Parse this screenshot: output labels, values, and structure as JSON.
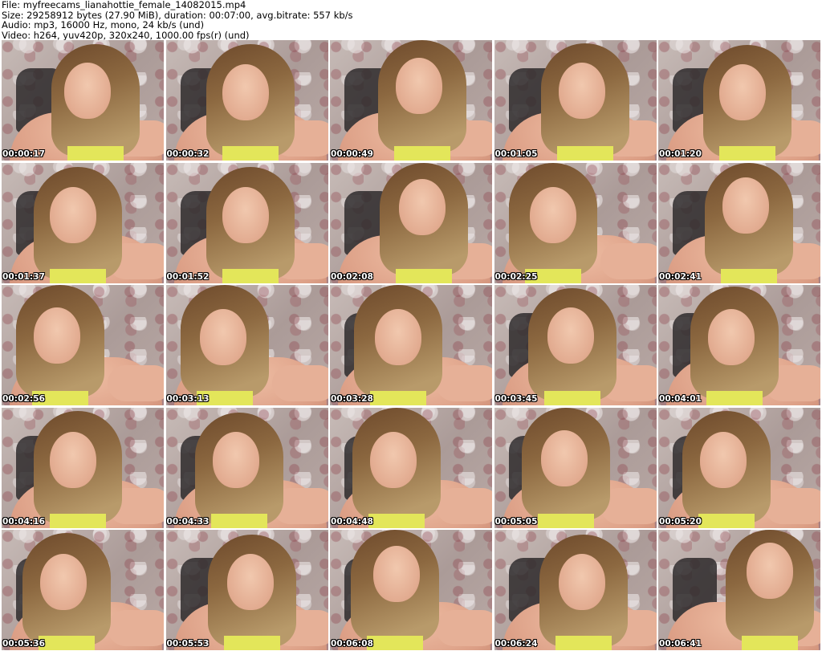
{
  "header": {
    "file_line": "File: myfreecams_lianahottie_female_14082015.mp4",
    "size_line": "Size: 29258912 bytes (27.90 MiB), duration: 00:07:00, avg.bitrate: 557 kb/s",
    "audio_line": "Audio: mp3, 16000 Hz, mono, 24 kb/s (und)",
    "video_line": "Video: h264, yuv420p, 320x240, 1000.00 fps(r) (und)"
  },
  "thumbnails": [
    {
      "timestamp": "00:00:17"
    },
    {
      "timestamp": "00:00:32"
    },
    {
      "timestamp": "00:00:49"
    },
    {
      "timestamp": "00:01:05"
    },
    {
      "timestamp": "00:01:20"
    },
    {
      "timestamp": "00:01:37"
    },
    {
      "timestamp": "00:01:52"
    },
    {
      "timestamp": "00:02:08"
    },
    {
      "timestamp": "00:02:25"
    },
    {
      "timestamp": "00:02:41"
    },
    {
      "timestamp": "00:02:56"
    },
    {
      "timestamp": "00:03:13"
    },
    {
      "timestamp": "00:03:28"
    },
    {
      "timestamp": "00:03:45"
    },
    {
      "timestamp": "00:04:01"
    },
    {
      "timestamp": "00:04:16"
    },
    {
      "timestamp": "00:04:33"
    },
    {
      "timestamp": "00:04:48"
    },
    {
      "timestamp": "00:05:05"
    },
    {
      "timestamp": "00:05:20"
    },
    {
      "timestamp": "00:05:36"
    },
    {
      "timestamp": "00:05:53"
    },
    {
      "timestamp": "00:06:08"
    },
    {
      "timestamp": "00:06:24"
    },
    {
      "timestamp": "00:06:41"
    }
  ],
  "colors": {
    "background": "#ffffff",
    "timestamp_text": "#ffffff",
    "timestamp_outline": "#000000"
  }
}
